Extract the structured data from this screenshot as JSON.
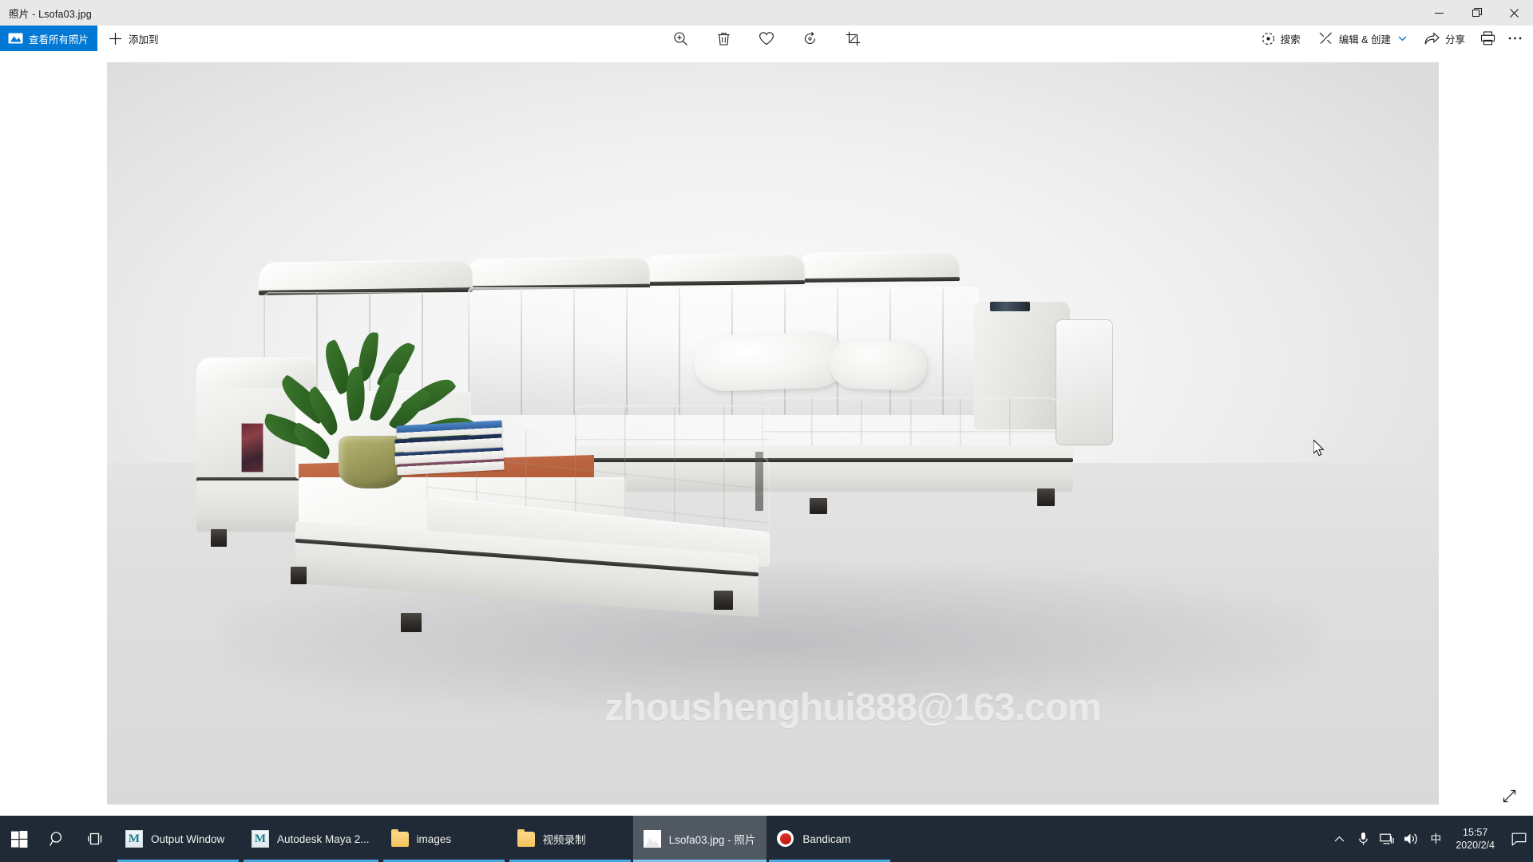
{
  "window": {
    "title": "照片 - Lsofa03.jpg",
    "controls": {
      "minimize": "minimize-icon",
      "restore": "restore-icon",
      "close": "close-icon"
    }
  },
  "commandbar": {
    "view_all_label": "查看所有照片",
    "view_all_icon": "photo-mountain-icon",
    "add_to_label": "添加到",
    "add_to_icon": "plus-icon",
    "center_tools": [
      {
        "name": "zoom-icon",
        "title": "缩放"
      },
      {
        "name": "delete-icon",
        "title": "删除"
      },
      {
        "name": "favorite-heart-icon",
        "title": "收藏"
      },
      {
        "name": "rotate-icon",
        "title": "旋转"
      },
      {
        "name": "crop-icon",
        "title": "裁剪"
      }
    ],
    "right_tools": [
      {
        "name": "search-icon",
        "label": "搜索"
      },
      {
        "name": "edit-create-icon",
        "label": "编辑 & 创建",
        "caret": "chevron-down-icon"
      },
      {
        "name": "share-icon",
        "label": "分享"
      },
      {
        "name": "print-icon",
        "label": ""
      },
      {
        "name": "more-ellipsis-icon",
        "label": ""
      }
    ]
  },
  "viewer": {
    "image_name": "Lsofa03.jpg",
    "watermark": "zhoushenghui888@163.com",
    "fullscreen_icon": "expand-diagonal-icon",
    "cursor_icon": "mouse-pointer-icon"
  },
  "taskbar": {
    "system_icons": [
      {
        "name": "start-button-icon"
      },
      {
        "name": "search-magnifier-icon"
      },
      {
        "name": "task-view-icon"
      }
    ],
    "apps": [
      {
        "label": "Output Window",
        "icon": "maya-icon",
        "active": false
      },
      {
        "label": "Autodesk Maya 2...",
        "icon": "maya-icon",
        "active": false
      },
      {
        "label": "images",
        "icon": "folder-icon",
        "active": false
      },
      {
        "label": "视频录制",
        "icon": "folder-icon",
        "active": false
      },
      {
        "label": "Lsofa03.jpg - 照片",
        "icon": "photos-icon",
        "active": true
      },
      {
        "label": "Bandicam",
        "icon": "bandicam-icon",
        "active": false
      }
    ],
    "tray": {
      "icons": [
        {
          "name": "chevron-up-icon"
        },
        {
          "name": "microphone-icon"
        },
        {
          "name": "network-icon"
        },
        {
          "name": "speaker-icon"
        }
      ],
      "ime": "中",
      "time": "15:57",
      "date": "2020/2/4",
      "notification_icon": "action-center-icon"
    }
  },
  "colors": {
    "accent": "#0078d4",
    "titlebar": "#e8e8e8",
    "taskbar": "#1f2a36",
    "canvas": "#ffffff",
    "image_bg": "#eeeeee"
  }
}
